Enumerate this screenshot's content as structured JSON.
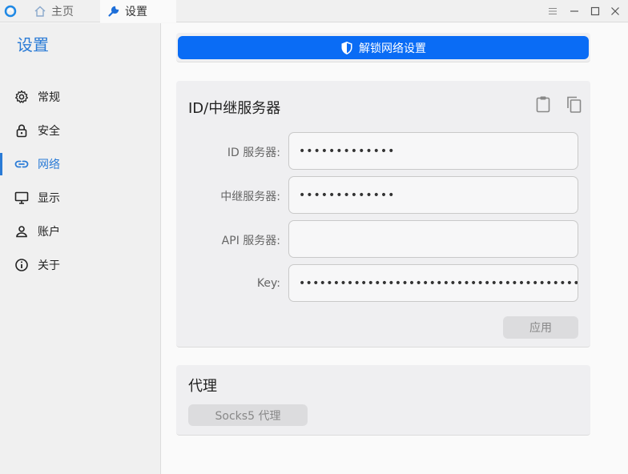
{
  "titlebar": {
    "tabs": [
      {
        "label": "主页",
        "icon": "home-icon"
      },
      {
        "label": "设置",
        "icon": "wrench-icon"
      }
    ],
    "window_buttons": [
      "menu-icon",
      "minimize-icon",
      "maximize-icon",
      "close-icon"
    ]
  },
  "sidebar": {
    "title": "设置",
    "items": [
      {
        "label": "常规",
        "icon": "gear-icon"
      },
      {
        "label": "安全",
        "icon": "lock-icon"
      },
      {
        "label": "网络",
        "icon": "link-icon",
        "active": true
      },
      {
        "label": "显示",
        "icon": "monitor-icon"
      },
      {
        "label": "账户",
        "icon": "user-icon"
      },
      {
        "label": "关于",
        "icon": "info-icon"
      }
    ]
  },
  "main": {
    "unlock_button": "解锁网络设置",
    "server_card": {
      "title": "ID/中继服务器",
      "fields": [
        {
          "label": "ID 服务器:",
          "value": "•••••••••••••"
        },
        {
          "label": "中继服务器:",
          "value": "•••••••••••••"
        },
        {
          "label": "API 服务器:",
          "value": ""
        },
        {
          "label": "Key:",
          "value": "•••••••••••••••••••••••••••••••••••••••••••"
        }
      ],
      "apply_button": "应用"
    },
    "proxy_card": {
      "title": "代理",
      "socks_button": "Socks5 代理"
    }
  },
  "colors": {
    "accent": "#2a7bd6",
    "primary_button": "#0a6cf5"
  }
}
